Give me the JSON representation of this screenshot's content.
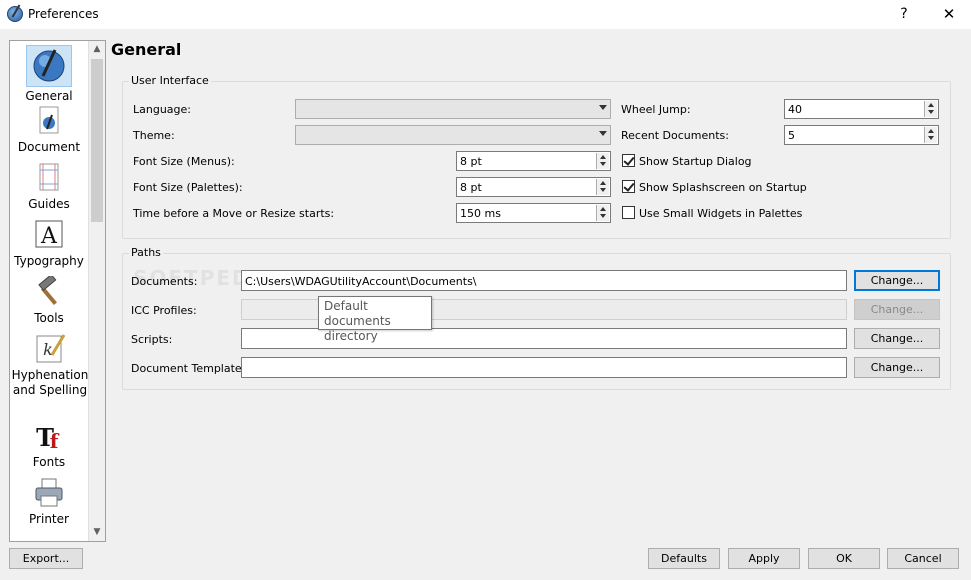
{
  "window": {
    "title": "Preferences",
    "help": "?",
    "close": "✕"
  },
  "sidebar": {
    "items": [
      {
        "label": "General",
        "icon": "scribus-icon"
      },
      {
        "label": "Document",
        "icon": "document-icon"
      },
      {
        "label": "Guides",
        "icon": "guides-icon"
      },
      {
        "label": "Typography",
        "icon": "typography-icon"
      },
      {
        "label": "Tools",
        "icon": "tools-hammer-icon"
      },
      {
        "label": "Hyphenation and Spelling",
        "icon": "hyphenation-icon"
      },
      {
        "label": "Fonts",
        "icon": "fonts-icon"
      },
      {
        "label": "Printer",
        "icon": "printer-icon"
      }
    ],
    "scroll_up": "▲",
    "scroll_down": "▼"
  },
  "page": {
    "title": "General"
  },
  "user_interface": {
    "title": "User Interface",
    "language_label": "Language:",
    "theme_label": "Theme:",
    "font_size_menus_label": "Font Size (Menus):",
    "font_size_menus_value": "8 pt",
    "font_size_palettes_label": "Font Size (Palettes):",
    "font_size_palettes_value": "8 pt",
    "move_resize_label": "Time before a Move or Resize starts:",
    "move_resize_value": "150 ms",
    "wheel_jump_label": "Wheel Jump:",
    "wheel_jump_value": "40",
    "recent_docs_label": "Recent Documents:",
    "recent_docs_value": "5",
    "show_startup_dialog": "Show Startup Dialog",
    "show_splashscreen": "Show Splashscreen on Startup",
    "small_widgets": "Use Small Widgets in Palettes"
  },
  "paths": {
    "title": "Paths",
    "documents_label": "Documents:",
    "documents_value": "C:\\Users\\WDAGUtilityAccount\\Documents\\",
    "icc_label": "ICC Profiles:",
    "scripts_label": "Scripts:",
    "templates_label": "Document Templates:",
    "change": "Change..."
  },
  "tooltip": {
    "text": "Default documents directory"
  },
  "watermark": "SOFTPEDIA",
  "footer": {
    "export": "Export...",
    "defaults": "Defaults",
    "apply": "Apply",
    "ok": "OK",
    "cancel": "Cancel"
  },
  "colors": {
    "accent": "#0078d7",
    "selection": "#cde4f7",
    "background": "#f0f0f0"
  }
}
